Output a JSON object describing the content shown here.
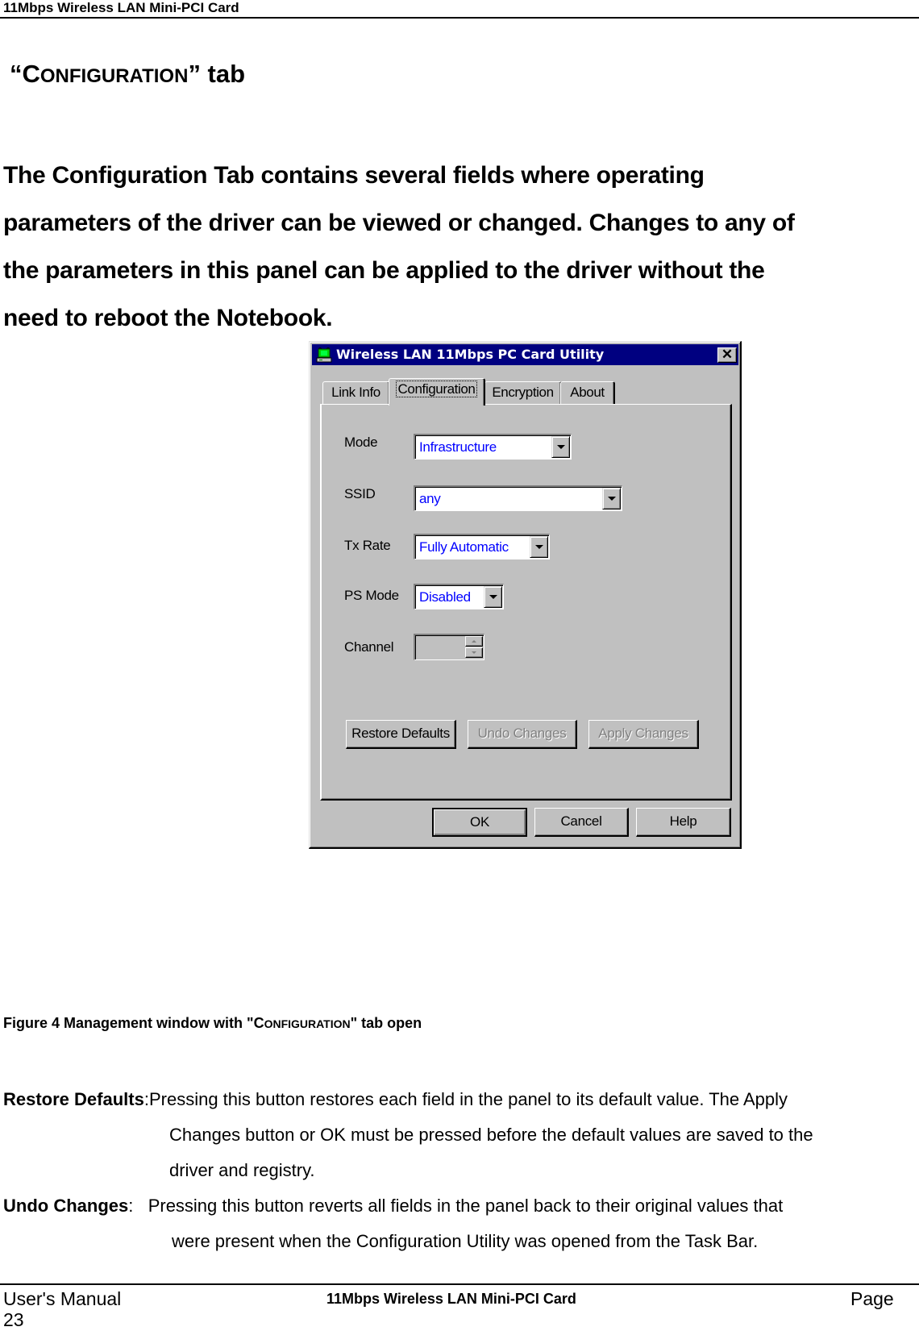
{
  "page_header": {
    "title": "11Mbps Wireless LAN Mini-PCI Card"
  },
  "section": {
    "title_open_quote": "“",
    "title_cap": "C",
    "title_smallcaps": "ONFIGURATION",
    "title_close_quote": "” tab",
    "intro_lines": [
      "The Configuration Tab contains several fields where operating",
      "parameters of the driver can be viewed or changed.  Changes to any of",
      "the parameters in this panel can be applied to the driver without the",
      "need to reboot the Notebook."
    ]
  },
  "dialog": {
    "title": "Wireless LAN 11Mbps PC Card Utility",
    "app_icon": "wireless-card-icon",
    "close_label": "✕",
    "tabs": [
      {
        "label": "Link Info",
        "selected": false
      },
      {
        "label": "Configuration",
        "selected": true
      },
      {
        "label": "Encryption",
        "selected": false
      },
      {
        "label": "About",
        "selected": false
      }
    ],
    "fields": {
      "mode": {
        "label": "Mode",
        "value": "Infrastructure"
      },
      "ssid": {
        "label": "SSID",
        "value": "any"
      },
      "tx_rate": {
        "label": "Tx Rate",
        "value": "Fully Automatic"
      },
      "ps_mode": {
        "label": "PS Mode",
        "value": "Disabled"
      },
      "channel": {
        "label": "Channel",
        "value": "",
        "disabled": true
      }
    },
    "panel_buttons": {
      "restore_defaults": {
        "label": "Restore Defaults",
        "enabled": true
      },
      "undo_changes": {
        "label": "Undo Changes",
        "enabled": false
      },
      "apply_changes": {
        "label": "Apply Changes",
        "enabled": false
      }
    },
    "footer_buttons": {
      "ok": "OK",
      "cancel": "Cancel",
      "help": "Help"
    },
    "colors": {
      "titlebar": "#000080",
      "face": "#c0c0c0",
      "combo_text": "#0000ff"
    }
  },
  "caption": {
    "prefix": "Figure 4 Management window with \"",
    "cap": "C",
    "smallcaps": "ONFIGURATION",
    "suffix": "\" tab open"
  },
  "definitions": [
    {
      "term": "Restore Defaults",
      "sep": ":",
      "lines": [
        "Pressing this button restores each field in the panel to its default value.  The Apply",
        "Changes button or OK must be pressed before the default values are saved to the",
        "driver and registry."
      ]
    },
    {
      "term": "Undo Changes",
      "sep": ":   ",
      "lines": [
        "Pressing this button reverts all fields in the panel back to their original values that",
        "were present when the Configuration Utility was opened from the Task Bar."
      ]
    }
  ],
  "page_footer": {
    "left": "User's Manual",
    "center": "11Mbps Wireless LAN Mini-PCI Card",
    "right": "Page",
    "page_number": "23"
  }
}
